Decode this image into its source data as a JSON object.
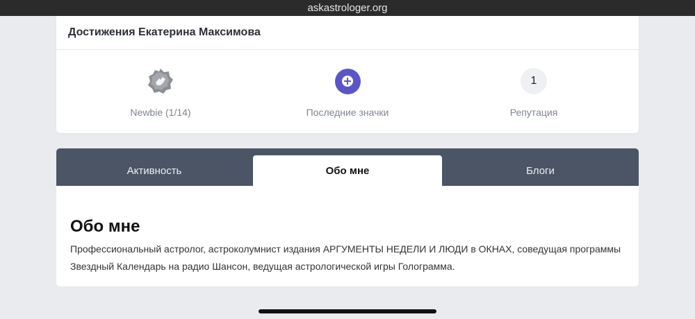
{
  "browser": {
    "url": "askastrologer.org"
  },
  "achievements": {
    "title": "Достижения Екатерина Максимова",
    "stats": [
      {
        "label": "Newbie (1/14)",
        "icon": "newbie-badge-icon"
      },
      {
        "label": "Последние значки",
        "icon": "plus-icon"
      },
      {
        "label": "Репутация",
        "value": "1"
      }
    ]
  },
  "tabs": [
    {
      "label": "Активность",
      "active": false
    },
    {
      "label": "Обо мне",
      "active": true
    },
    {
      "label": "Блоги",
      "active": false
    }
  ],
  "about": {
    "heading": "Обо мне",
    "text": "Профессиональный астролог, астроколумнист издания АРГУМЕНТЫ НЕДЕЛИ И ЛЮДИ в ОКНАХ, соведущая программы Звездный Календарь на радио Шансон, ведущая астрологической игры Голограмма."
  },
  "colors": {
    "tabs_bar": "#4b5565",
    "accent_purple": "#5a55c9",
    "background": "#e9ebef"
  }
}
